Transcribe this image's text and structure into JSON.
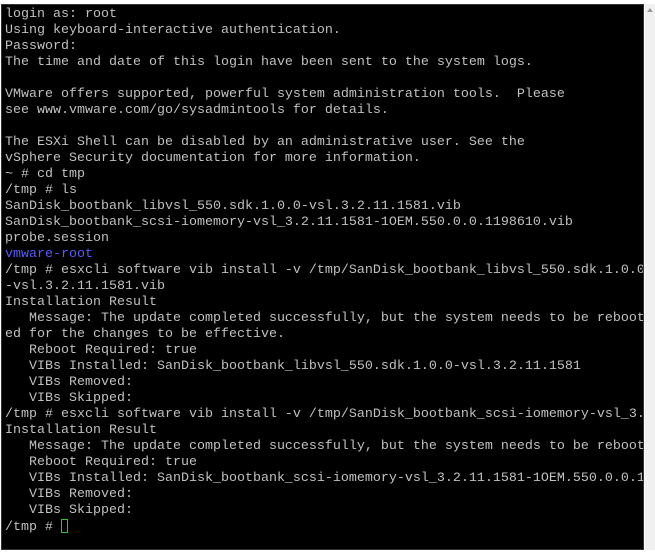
{
  "terminal": {
    "lines": [
      {
        "text": "login as: root"
      },
      {
        "text": "Using keyboard-interactive authentication."
      },
      {
        "text": "Password:"
      },
      {
        "text": "The time and date of this login have been sent to the system logs."
      },
      {
        "text": ""
      },
      {
        "text": "VMware offers supported, powerful system administration tools.  Please"
      },
      {
        "text": "see www.vmware.com/go/sysadmintools for details."
      },
      {
        "text": ""
      },
      {
        "text": "The ESXi Shell can be disabled by an administrative user. See the"
      },
      {
        "text": "vSphere Security documentation for more information."
      },
      {
        "text": "~ # cd tmp"
      },
      {
        "text": "/tmp # ls"
      },
      {
        "text": "SanDisk_bootbank_libvsl_550.sdk.1.0.0-vsl.3.2.11.1581.vib"
      },
      {
        "text": "SanDisk_bootbank_scsi-iomemory-vsl_3.2.11.1581-1OEM.550.0.0.1198610.vib"
      },
      {
        "text": "probe.session"
      },
      {
        "text": "vmware-root",
        "type": "directory"
      },
      {
        "text": "/tmp # esxcli software vib install -v /tmp/SanDisk_bootbank_libvsl_550.sdk.1.0.0"
      },
      {
        "text": "-vsl.3.2.11.1581.vib"
      },
      {
        "text": "Installation Result"
      },
      {
        "text": "   Message: The update completed successfully, but the system needs to be reboot"
      },
      {
        "text": "ed for the changes to be effective."
      },
      {
        "text": "   Reboot Required: true"
      },
      {
        "text": "   VIBs Installed: SanDisk_bootbank_libvsl_550.sdk.1.0.0-vsl.3.2.11.1581"
      },
      {
        "text": "   VIBs Removed:"
      },
      {
        "text": "   VIBs Skipped:"
      },
      {
        "text": "/tmp # esxcli software vib install -v /tmp/SanDisk_bootbank_scsi-iomemory-vsl_3."
      },
      {
        "text": "Installation Result"
      },
      {
        "text": "   Message: The update completed successfully, but the system needs to be reboot"
      },
      {
        "text": "   Reboot Required: true"
      },
      {
        "text": "   VIBs Installed: SanDisk_bootbank_scsi-iomemory-vsl_3.2.11.1581-1OEM.550.0.0.1"
      },
      {
        "text": "   VIBs Removed:"
      },
      {
        "text": "   VIBs Skipped:"
      }
    ],
    "prompt": "/tmp # ",
    "colors": {
      "background": "#000000",
      "text": "#c0c0c0",
      "directory": "#5a5aff",
      "cursor": "#22cc22"
    }
  }
}
